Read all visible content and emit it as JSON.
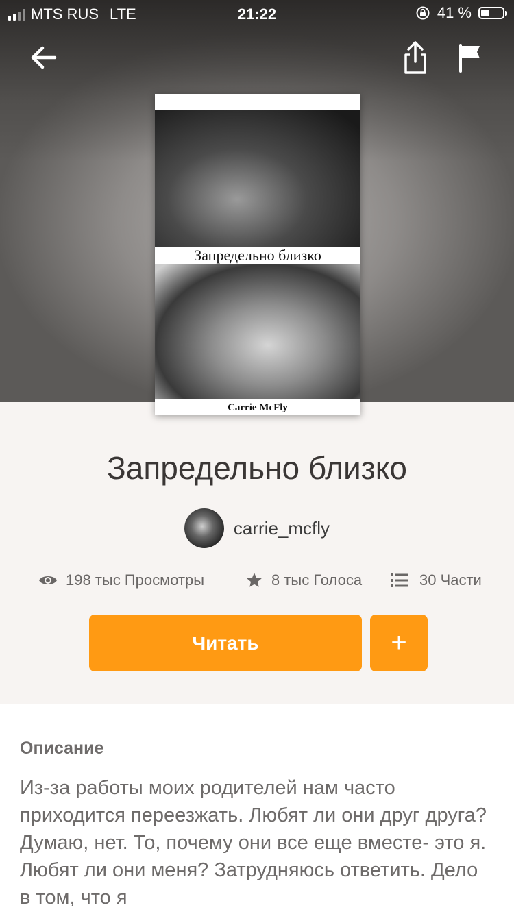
{
  "status_bar": {
    "carrier": "MTS RUS",
    "network": "LTE",
    "time": "21:22",
    "battery_percent": "41 %",
    "battery_level": 0.41,
    "signal_bars": 2
  },
  "nav": {
    "back_icon": "arrow-left-icon",
    "share_icon": "share-icon",
    "report_icon": "flag-icon"
  },
  "cover": {
    "title": "Запредельно близко",
    "author": "Carrie McFly"
  },
  "story": {
    "title": "Запредельно близко",
    "author_username": "carrie_mcfly"
  },
  "stats": {
    "views": "198 тыс Просмотры",
    "votes": "8 тыс Голоса",
    "parts": "30 Части"
  },
  "actions": {
    "read_label": "Читать",
    "add_label": "+"
  },
  "description": {
    "label": "Описание",
    "text": "Из-за работы моих родителей нам часто приходится переезжать. Любят ли они друг друга? Думаю, нет. То, почему они все еще вместе- это я. Любят ли они меня? Затрудняюсь ответить. Дело в том, что я"
  },
  "colors": {
    "accent": "#ff9a13",
    "background": "#f7f4f2",
    "text_muted": "#6e6b6a"
  }
}
